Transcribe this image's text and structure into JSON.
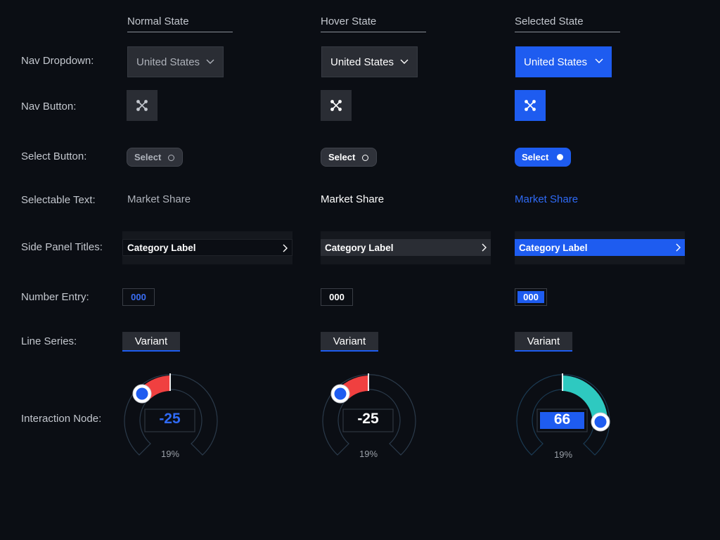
{
  "columns": [
    "Normal State",
    "Hover State",
    "Selected State"
  ],
  "rows": {
    "nav_dropdown": "Nav Dropdown:",
    "nav_button": "Nav Button:",
    "select_button": "Select Button:",
    "selectable_text": "Selectable Text:",
    "side_panel_titles": "Side Panel Titles:",
    "number_entry": "Number Entry:",
    "line_series": "Line Series:",
    "interaction_node": "Interaction Node:"
  },
  "dropdown": {
    "value": "United States"
  },
  "select_button": {
    "label": "Select"
  },
  "selectable_text": {
    "label": "Market Share"
  },
  "side_panel": {
    "label": "Category Label"
  },
  "number_entry": {
    "value": "000"
  },
  "line_series": {
    "label": "Variant"
  },
  "knobs": [
    {
      "value": "-25",
      "percent": "19%",
      "state": "normal"
    },
    {
      "value": "-25",
      "percent": "19%",
      "state": "hover"
    },
    {
      "value": "66",
      "percent": "19%",
      "state": "selected"
    }
  ],
  "colors": {
    "background": "#0b0e14",
    "accent_blue": "#1e5cf0",
    "negative_red": "#f04040",
    "positive_teal": "#2ec9c0",
    "control_gray": "#2a2d34"
  },
  "icons": {
    "dropdown": "chevron-down-icon",
    "nav_button": "network-nodes-icon",
    "select_button": "radio-dot-icon",
    "side_panel": "chevron-right-icon"
  }
}
